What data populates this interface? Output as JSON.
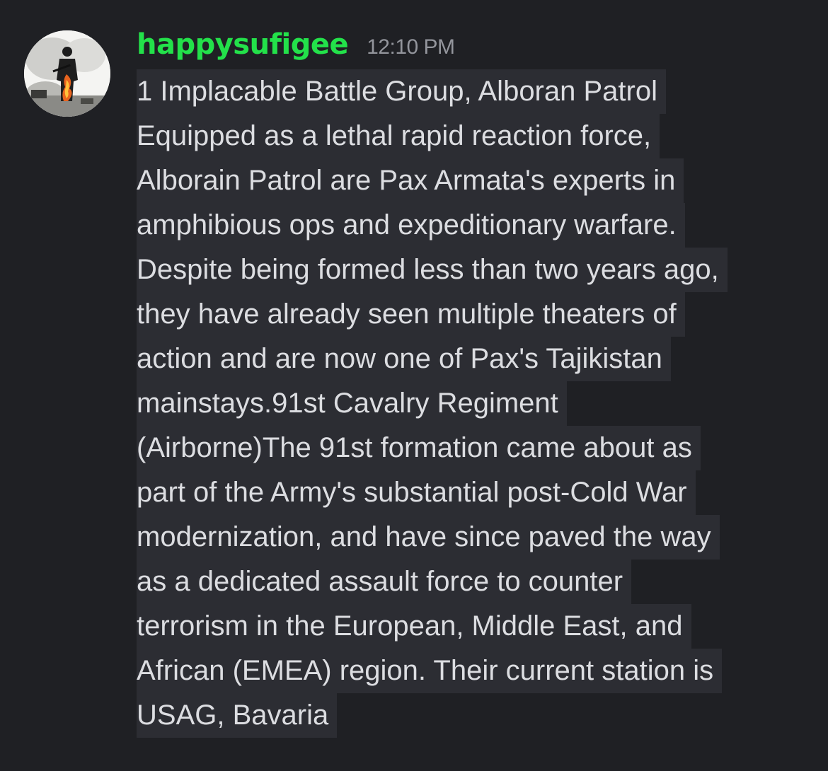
{
  "message": {
    "author": "happysufigee",
    "timestamp": "12:10 PM",
    "author_color": "#23e14a",
    "avatar_icon": "soldier-avatar-icon",
    "lines": [
      "1 Implacable Battle Group, Alboran Patrol",
      "Equipped as a lethal rapid reaction force,",
      "Alborain Patrol are Pax Armata's experts in",
      "amphibious ops and expeditionary warfare.",
      "Despite being formed less than two years ago,",
      "they have already seen multiple theaters of",
      "action and are now one of Pax's Tajikistan",
      "mainstays.91st Cavalry Regiment",
      "(Airborne)The 91st formation came about as",
      "part of the Army's substantial post-Cold War",
      "modernization, and have since paved the way",
      "as a dedicated assault force to counter",
      "terrorism in the European, Middle East, and",
      "African (EMEA) region. Their current station is",
      "USAG, Bavaria"
    ]
  }
}
